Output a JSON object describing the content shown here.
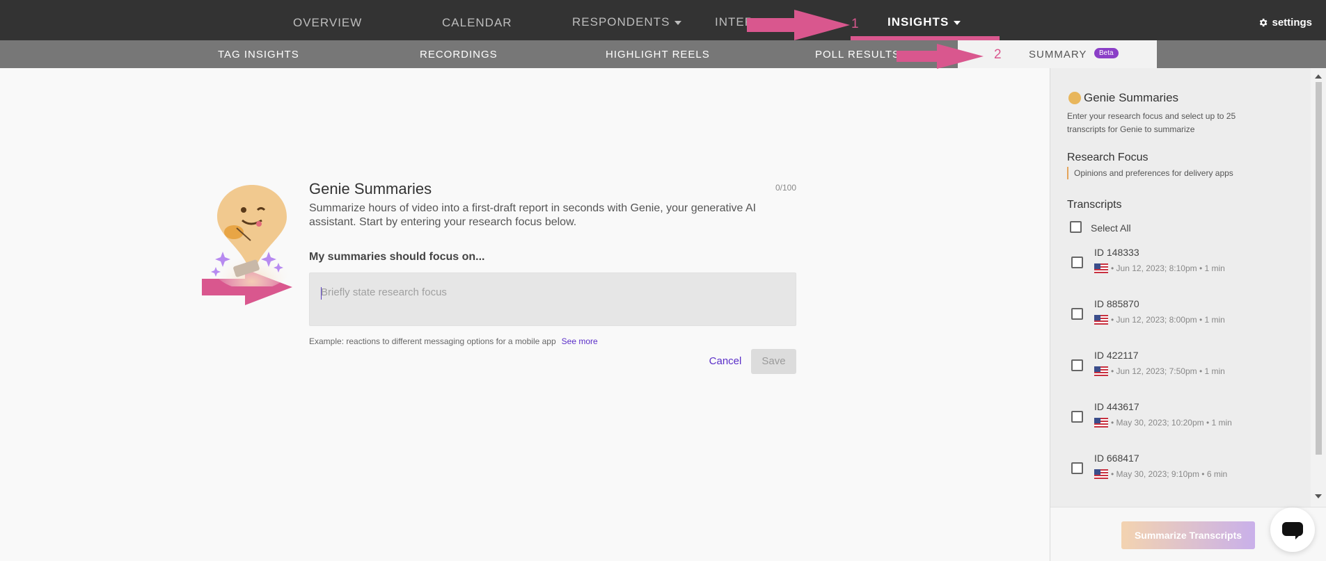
{
  "nav": {
    "overview": "OVERVIEW",
    "calendar": "CALENDAR",
    "respondents": "RESPONDENTS",
    "interviews": "INTER",
    "insights": "INSIGHTS",
    "settings": "settings"
  },
  "subnav": {
    "tag_insights": "TAG INSIGHTS",
    "recordings": "RECORDINGS",
    "highlight_reels": "HIGHLIGHT REELS",
    "poll_results": "POLL RESULTS",
    "summary": "SUMMARY",
    "beta": "Beta"
  },
  "annotations": {
    "step1": "1",
    "step2": "2",
    "color": "#d9578e"
  },
  "main": {
    "title": "Genie Summaries",
    "counter": "0/100",
    "description": "Summarize hours of video into a first-draft report in seconds with Genie, your generative AI assistant. Start by entering your research focus below.",
    "focus_label": "My summaries should focus on...",
    "focus_placeholder": "Briefly state research focus",
    "example": "Example: reactions to different messaging options for a mobile app",
    "see_more": "See more",
    "cancel": "Cancel",
    "save": "Save"
  },
  "panel": {
    "title": "Genie Summaries",
    "description": "Enter your research focus and select up to 25 transcripts for Genie to summarize",
    "research_focus_title": "Research Focus",
    "research_focus_value": "Opinions and preferences for delivery apps",
    "transcripts_title": "Transcripts",
    "select_all": "Select All",
    "transcripts": [
      {
        "id": "ID 148333",
        "meta": "• Jun 12, 2023; 8:10pm • 1 min"
      },
      {
        "id": "ID 885870",
        "meta": "• Jun 12, 2023; 8:00pm • 1 min"
      },
      {
        "id": "ID 422117",
        "meta": "• Jun 12, 2023; 7:50pm • 1 min"
      },
      {
        "id": "ID 443617",
        "meta": "• May 30, 2023; 10:20pm • 1 min"
      },
      {
        "id": "ID 668417",
        "meta": "• May 30, 2023; 9:10pm • 6 min"
      }
    ],
    "summarize_button": "Summarize Transcripts"
  },
  "colors": {
    "accent": "#5a2ec8",
    "topnav": "#333333",
    "subnav": "#777777",
    "beta": "#8b3fc7"
  }
}
